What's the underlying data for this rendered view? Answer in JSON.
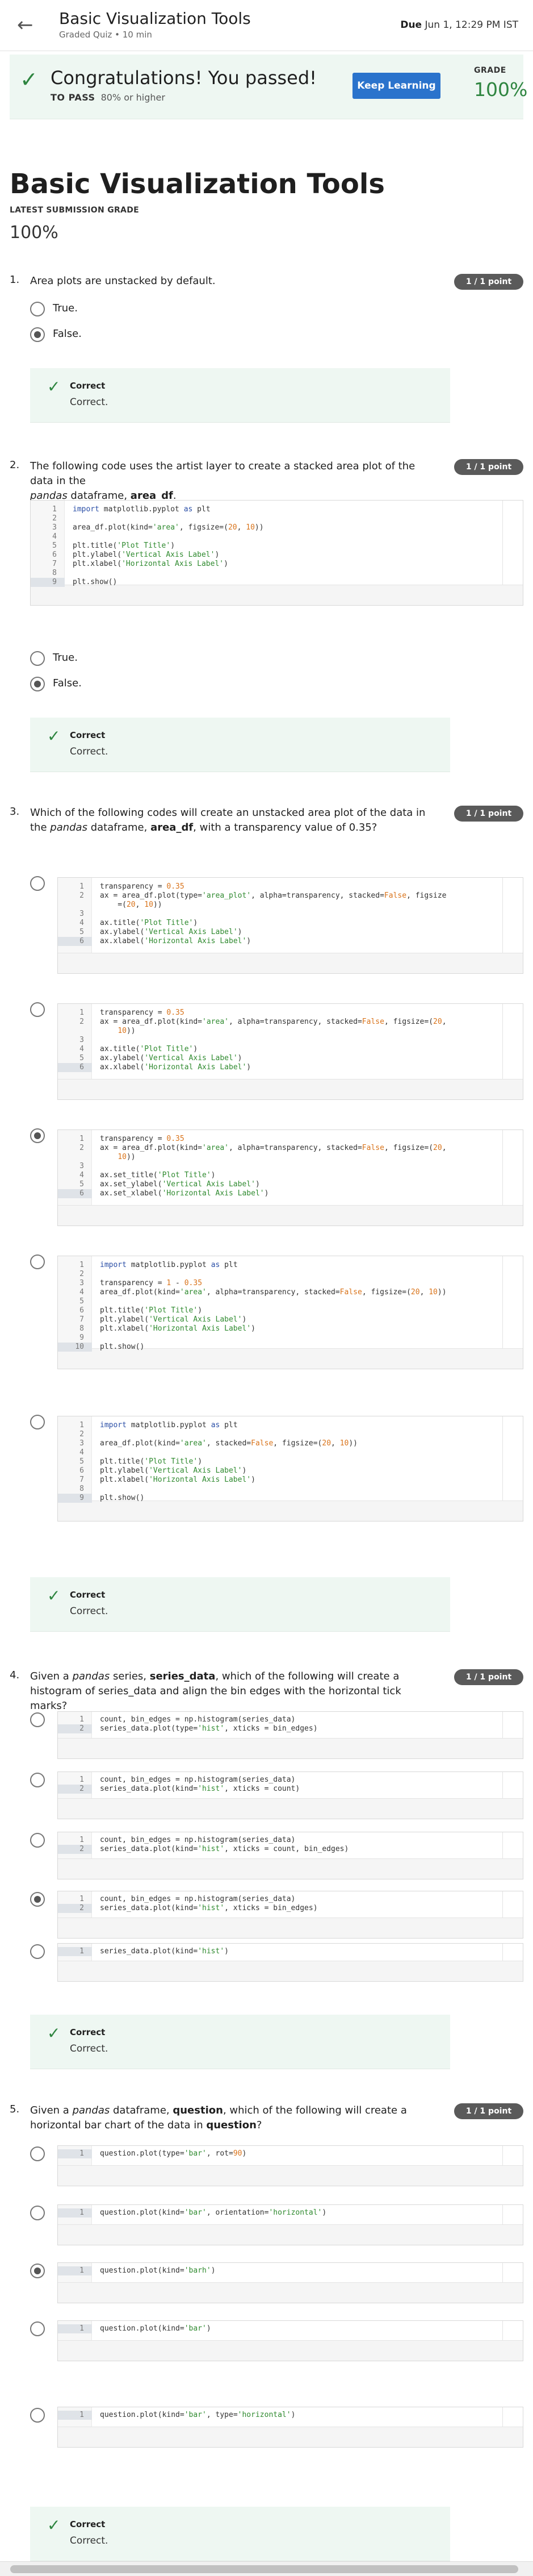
{
  "header": {
    "title": "Basic Visualization Tools",
    "subtitle": "Graded Quiz • 10 min",
    "due_label": "Due",
    "due_value": "Jun 1, 12:29 PM IST"
  },
  "banner": {
    "congrats": "Congratulations! You passed!",
    "to_pass_label": "TO PASS",
    "to_pass_value": "80% or higher",
    "keep_learning": "Keep Learning",
    "grade_label": "GRADE",
    "grade_value": "100%"
  },
  "page": {
    "title": "Basic Visualization Tools",
    "latest_label": "LATEST SUBMISSION GRADE",
    "latest_value": "100%"
  },
  "points": "1 / 1 point",
  "feedback": {
    "title": "Correct",
    "text": "Correct."
  },
  "q1": {
    "num": "1.",
    "text": "Area plots are unstacked by default.",
    "options": [
      "True.",
      "False."
    ]
  },
  "q2": {
    "num": "2.",
    "text_a": "The following code uses the artist layer to create a stacked area plot of the data in the",
    "text_i": "pandas",
    "text_b": " dataframe, ",
    "text_bold": "area_df",
    "text_c": ".",
    "options": [
      "True.",
      "False."
    ]
  },
  "q3": {
    "num": "3.",
    "text_a": "Which of the following codes will create an unstacked area plot of the data in the ",
    "text_i": "pandas",
    "text_b": " dataframe, ",
    "text_bold": "area_df",
    "text_c": ", with a transparency value of 0.35?"
  },
  "q4": {
    "num": "4.",
    "text_a": "Given a ",
    "text_i": "pandas",
    "text_b": " series, ",
    "text_bold": "series_data",
    "text_c": ", which of the following will create a histogram of series_data and align the bin edges with the horizontal tick marks?"
  },
  "q5": {
    "num": "5.",
    "text_a": "Given a ",
    "text_i": "pandas",
    "text_b": " dataframe, ",
    "text_bold": "question",
    "text_c": ", which of the following will create a horizontal bar chart of the data in ",
    "text_bold2": "question",
    "text_d": "?"
  }
}
